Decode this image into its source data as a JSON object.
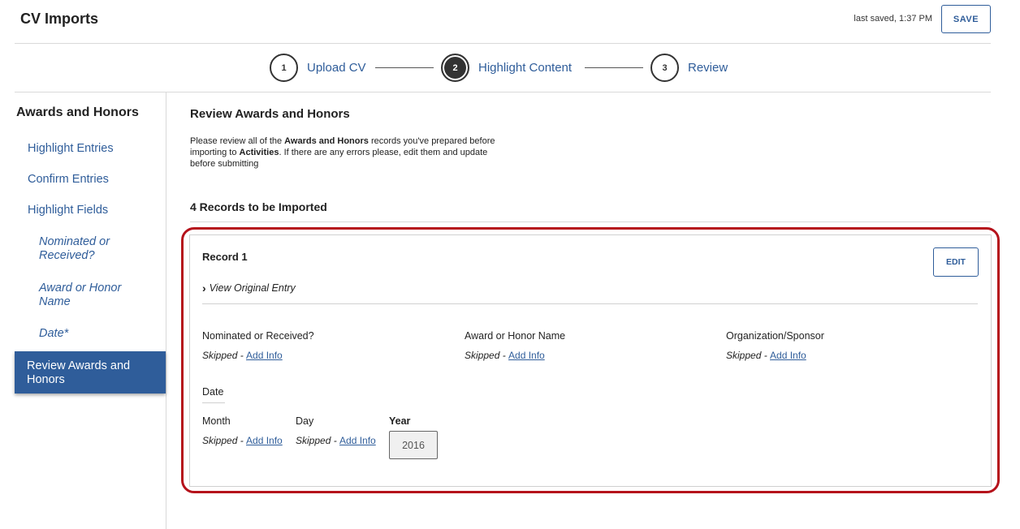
{
  "header": {
    "title": "CV Imports",
    "last_saved": "last saved, 1:37 PM",
    "save_label": "SAVE"
  },
  "stepper": {
    "steps": [
      {
        "number": "1",
        "label": "Upload CV",
        "state": "complete"
      },
      {
        "number": "2",
        "label": "Highlight Content",
        "state": "current"
      },
      {
        "number": "3",
        "label": "Review",
        "state": "upcoming"
      }
    ]
  },
  "sidebar": {
    "title": "Awards and Honors",
    "items": [
      {
        "label": "Highlight Entries"
      },
      {
        "label": "Confirm Entries"
      },
      {
        "label": "Highlight Fields"
      }
    ],
    "subitems": [
      {
        "label": "Nominated or Received?"
      },
      {
        "label": "Award or Honor Name"
      },
      {
        "label": "Date*"
      }
    ],
    "active_item": "Review Awards and Honors"
  },
  "main": {
    "title": "Review Awards and Honors",
    "intro": {
      "part1": "Please review all of the ",
      "bold1": "Awards and Honors",
      "part2": " records you've prepared before importing to ",
      "bold2": "Activities",
      "part3": ". If there are any errors please, edit them and update before submitting"
    },
    "records_count": "4 Records to be Imported"
  },
  "record": {
    "title": "Record 1",
    "edit_label": "EDIT",
    "view_original": "View Original Entry",
    "fields": [
      {
        "label": "Nominated or Received?",
        "status": "Skipped - ",
        "action": "Add Info"
      },
      {
        "label": "Award or Honor Name",
        "status": "Skipped - ",
        "action": "Add Info"
      },
      {
        "label": "Organization/Sponsor",
        "status": "Skipped - ",
        "action": "Add Info"
      }
    ],
    "date": {
      "label": "Date",
      "month": {
        "label": "Month",
        "status": "Skipped - ",
        "action": "Add Info"
      },
      "day": {
        "label": "Day",
        "status": "Skipped - ",
        "action": "Add Info"
      },
      "year": {
        "label": "Year",
        "value": "2016"
      }
    }
  },
  "colors": {
    "accent": "#2f5d9a",
    "highlight": "#b5121b",
    "text": "#222222"
  }
}
